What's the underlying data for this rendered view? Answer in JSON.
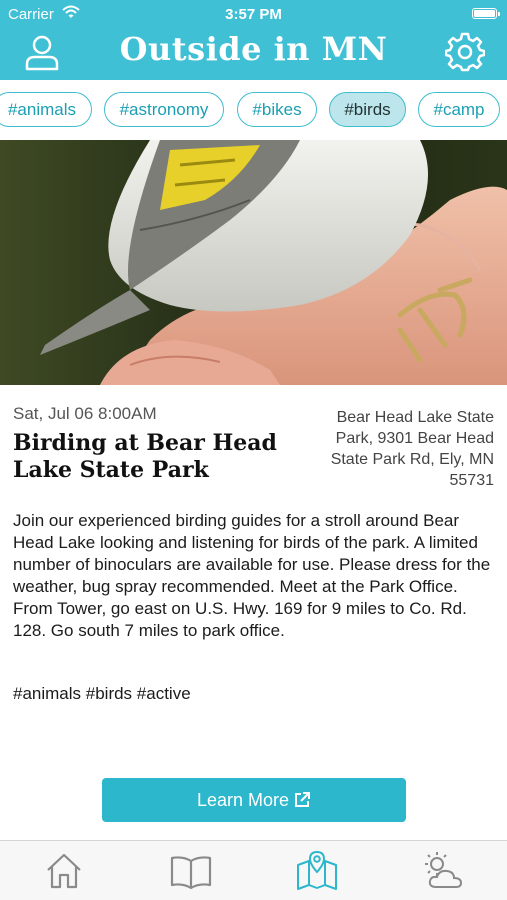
{
  "status_bar": {
    "carrier": "Carrier",
    "time": "3:57 PM"
  },
  "header": {
    "title": "Outside in MN",
    "left_icon": "user-icon",
    "right_icon": "gear-icon"
  },
  "tags": [
    "#animals",
    "#astronomy",
    "#bikes",
    "#birds",
    "#camp"
  ],
  "active_tag": "#birds",
  "event": {
    "date": "Sat, Jul 06 8:00AM",
    "title": "Birding at Bear Head Lake State Park",
    "location": "Bear Head Lake State Park, 9301 Bear Head State Park Rd, Ely, MN 55731",
    "description": "Join our experienced birding guides for a stroll around Bear Head Lake looking and listening for birds of the park. A limited number of binoculars are available for use. Please dress for the weather, bug spray recommended. Meet at the Park Office. From Tower, go east on U.S. Hwy. 169 for 9 miles to Co. Rd. 128. Go south 7 miles to park office.",
    "hashtags": "#animals #birds #active",
    "button_label": "Learn More"
  },
  "tab_bar": [
    {
      "icon": "home-icon"
    },
    {
      "icon": "book-icon"
    },
    {
      "icon": "map-pin-icon",
      "active": true
    },
    {
      "icon": "weather-icon"
    }
  ],
  "colors": {
    "brand": "#3fc0d5",
    "button": "#2cb7cc",
    "tag_active_bg": "#bde6ec",
    "tag_text": "#1b9fb3"
  }
}
